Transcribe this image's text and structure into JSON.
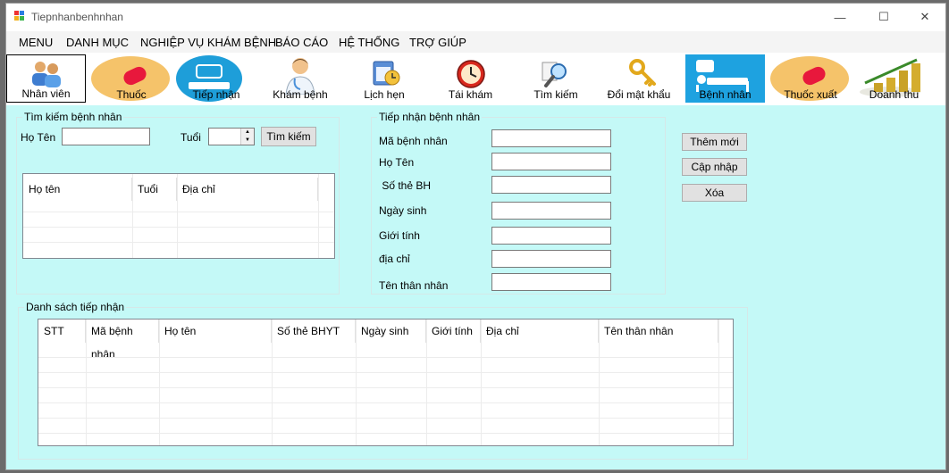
{
  "window": {
    "title": "Tiepnhanbenhnhan"
  },
  "menu": [
    "MENU",
    "DANH MỤC",
    "NGHIỆP VỤ KHÁM BỆNH",
    "BÁO CÁO",
    "HỆ THỐNG",
    "TRỢ GIÚP"
  ],
  "toolbar": [
    {
      "label": "Nhân viên",
      "icon": "staff-icon"
    },
    {
      "label": "Thuốc",
      "icon": "pill-icon"
    },
    {
      "label": "Tiếp nhận",
      "icon": "reception-icon"
    },
    {
      "label": "Khám bệnh",
      "icon": "doctor-icon"
    },
    {
      "label": "Lịch hẹn",
      "icon": "calendar-icon"
    },
    {
      "label": "Tái khám",
      "icon": "clock-icon"
    },
    {
      "label": "Tìm kiếm",
      "icon": "search-icon"
    },
    {
      "label": "Đổi mật khẩu",
      "icon": "key-icon"
    },
    {
      "label": "Bệnh nhân",
      "icon": "patient-bed-icon"
    },
    {
      "label": "Thuốc xuất",
      "icon": "pill-icon"
    },
    {
      "label": "Doanh thu",
      "icon": "revenue-icon"
    }
  ],
  "search_group": {
    "title": "Tìm kiếm bệnh nhân",
    "name_label": "Họ Tên",
    "name_value": "",
    "age_label": "Tuổi",
    "age_value": "",
    "search_button": "Tìm kiếm",
    "columns": [
      "Họ tên",
      "Tuổi",
      "Địa chỉ"
    ]
  },
  "reception_group": {
    "title": "Tiếp nhận bệnh nhân",
    "fields": [
      {
        "label": "Mã bệnh nhân",
        "value": ""
      },
      {
        "label": "Họ Tên",
        "value": ""
      },
      {
        "label": " Số thẻ BH",
        "value": ""
      },
      {
        "label": "Ngày sinh",
        "value": ""
      },
      {
        "label": "Giới tính",
        "value": ""
      },
      {
        "label": "địa chỉ",
        "value": ""
      },
      {
        "label": "Tên thân nhân",
        "value": ""
      }
    ]
  },
  "actions": {
    "add": "Thêm mới",
    "update": "Cập nhập",
    "delete": "Xóa"
  },
  "list_group": {
    "title": "Danh sách tiếp nhận",
    "columns": [
      "STT",
      "Mã bệnh nhân",
      "Họ tên",
      "Số thẻ BHYT",
      "Ngày sinh",
      "Giới tính",
      "Địa chỉ",
      "Tên thân nhân"
    ]
  }
}
